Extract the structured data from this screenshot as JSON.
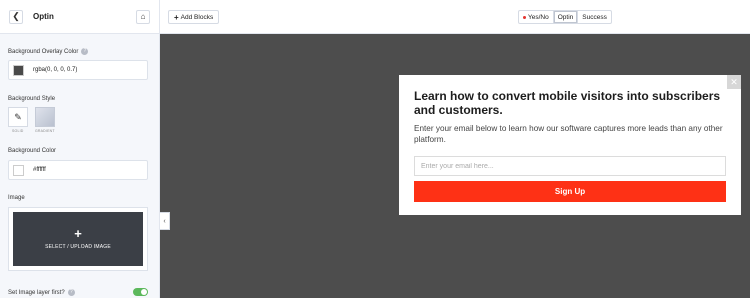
{
  "sidebar": {
    "title": "Optin",
    "overlay_color_label": "Background Overlay Color",
    "overlay_color_value": "rgba(0, 0, 0, 0.7)",
    "overlay_swatch": "#4a4a4a",
    "background_style_label": "Background Style",
    "style_options": [
      {
        "label": "SOLID"
      },
      {
        "label": "GRADIENT"
      }
    ],
    "background_color_label": "Background Color",
    "background_color_value": "#ffffff",
    "image_label": "Image",
    "upload_label": "SELECT / UPLOAD IMAGE",
    "image_layer_label": "Set Image layer first?",
    "image_layer_enabled": true
  },
  "topbar": {
    "add_blocks_label": "Add Blocks",
    "tabs": [
      {
        "label": "Yes/No"
      },
      {
        "label": "Optin",
        "active": true
      },
      {
        "label": "Success"
      }
    ]
  },
  "optin": {
    "headline": "Learn how to convert mobile visitors into subscribers and customers.",
    "subtext": "Enter your email below to learn how our software captures more leads than any other platform.",
    "email_placeholder": "Enter your email here...",
    "button_label": "Sign Up",
    "button_color": "#fe3115"
  },
  "colors": {
    "canvas": "#4d4d4d",
    "accent_toggle": "#5cb85c"
  }
}
